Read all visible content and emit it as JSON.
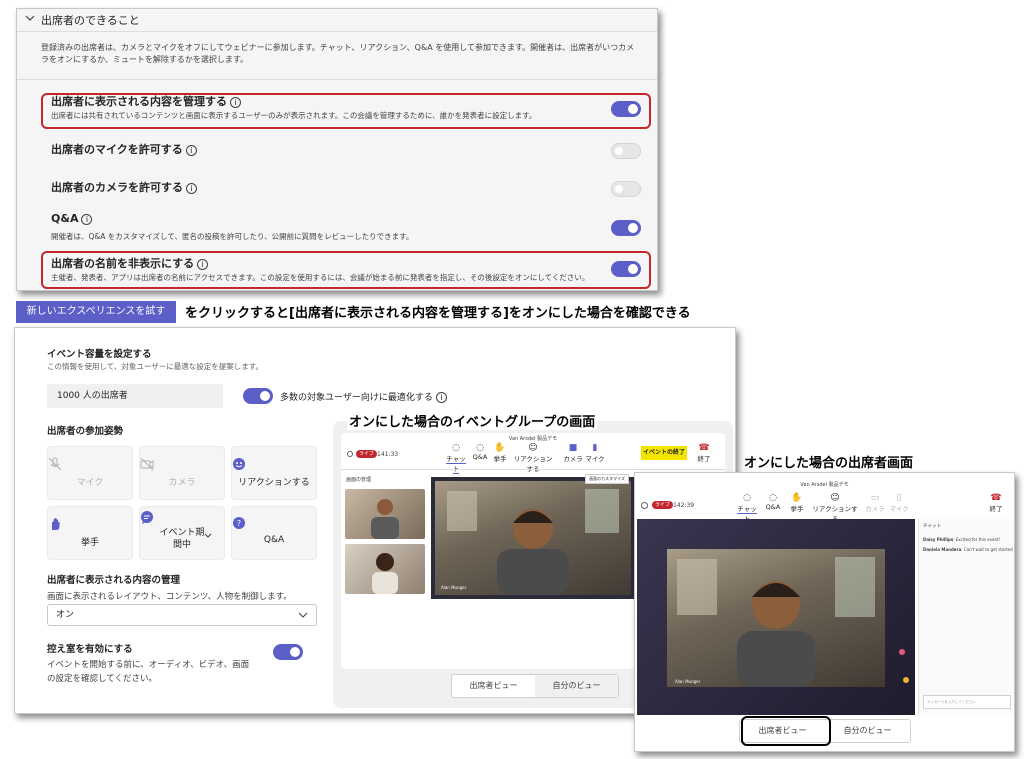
{
  "panel1": {
    "section_title": "出席者のできること",
    "section_desc": "登録済みの出席者は、カメラとマイクをオフにしてウェビナーに参加します。チャット、リアクション、Q&A を使用して参加できます。開催者は、出席者がいつカメラをオンにするか、ミュートを解除するかを選択します。",
    "settings": [
      {
        "label": "出席者に表示される内容を管理する",
        "desc": "出席者には共有されているコンテンツと画面に表示するユーザーのみが表示されます。この会議を管理するために、誰かを発表者に設定します。",
        "state": "on"
      },
      {
        "label": "出席者のマイクを許可する",
        "desc": "",
        "state": "off"
      },
      {
        "label": "出席者のカメラを許可する",
        "desc": "",
        "state": "off"
      },
      {
        "label": "Q&A",
        "desc": "開催者は、Q&A をカスタマイズして、匿名の投稿を許可したり、公開前に質問をレビューしたりできます。",
        "state": "on"
      },
      {
        "label": "出席者の名前を非表示にする",
        "desc": "主催者、発表者、アプリは出席者の名前にアクセスできます。この設定を使用するには、会議が始まる前に発表者を指定し、その後設定をオンにしてください。",
        "state": "on"
      }
    ]
  },
  "banner": {
    "button_label": "新しいエクスペリエンスを試す",
    "caption": "をクリックすると[出席者に表示される内容を管理する]をオンにした場合を確認できる"
  },
  "panel2": {
    "capacity_title": "イベント容量を設定する",
    "capacity_desc": "この情報を使用して、対象ユーザーに最適な設定を提案します。",
    "capacity_value": "1000 人の出席者",
    "optimize_label": "多数の対象ユーザー向けに最適化する",
    "participation_title": "出席者の参加姿勢",
    "tiles": [
      {
        "label": "マイク",
        "icon": "mic-off-icon",
        "enabled": false
      },
      {
        "label": "カメラ",
        "icon": "camera-off-icon",
        "enabled": false
      },
      {
        "label": "リアクションする",
        "icon": "emoji-icon",
        "enabled": true
      },
      {
        "label": "挙手",
        "icon": "raise-hand-icon",
        "enabled": true
      },
      {
        "label": "イベント期間中",
        "icon": "chat-icon",
        "enabled": true
      },
      {
        "label": "Q&A",
        "icon": "qa-icon",
        "enabled": true
      }
    ],
    "manage_title": "出席者に表示される内容の管理",
    "manage_desc": "画面に表示されるレイアウト、コンテンツ、人物を制御します。",
    "manage_value": "オン",
    "greenroom_title": "控え室を有効にする",
    "greenroom_desc": "イベントを開始する前に、オーディオ、ビデオ、画面の設定を確認してください。",
    "preview_caption": "オンにした場合のイベントグループの画面",
    "preview": {
      "meeting_title": "Van Arsdel 製品デモ",
      "live_badge": "ライブ",
      "timer": "141:33",
      "toolbar": [
        "チャット",
        "Q&A",
        "挙手",
        "リアクションする",
        "カメラ",
        "マイク"
      ],
      "end_event": "イベントの終了",
      "leave": "終了",
      "manage_label": "画面の管理",
      "main_name": "Alan Munger",
      "side_button": "画面のカスタマイズ",
      "view_tabs": [
        "出席者ビュー",
        "自分のビュー"
      ]
    }
  },
  "panel3": {
    "caption": "オンにした場合の出席者画面",
    "meeting_title": "Van Arsdel 製品デモ",
    "live_badge": "ライブ",
    "timer": "142:39",
    "toolbar": [
      "チャット",
      "Q&A",
      "挙手",
      "リアクションする",
      "カメラ",
      "マイク"
    ],
    "leave": "終了",
    "chat_title": "チャット",
    "chat_messages": [
      {
        "name": "Daisy Phillips",
        "text": "Excited for this event!"
      },
      {
        "name": "Daniela Mandera",
        "text": "Can't wait to get started"
      }
    ],
    "chat_placeholder": "メッセージを入力してください",
    "main_name": "Alan Munger",
    "view_tabs": [
      "出席者ビュー",
      "自分のビュー"
    ]
  }
}
